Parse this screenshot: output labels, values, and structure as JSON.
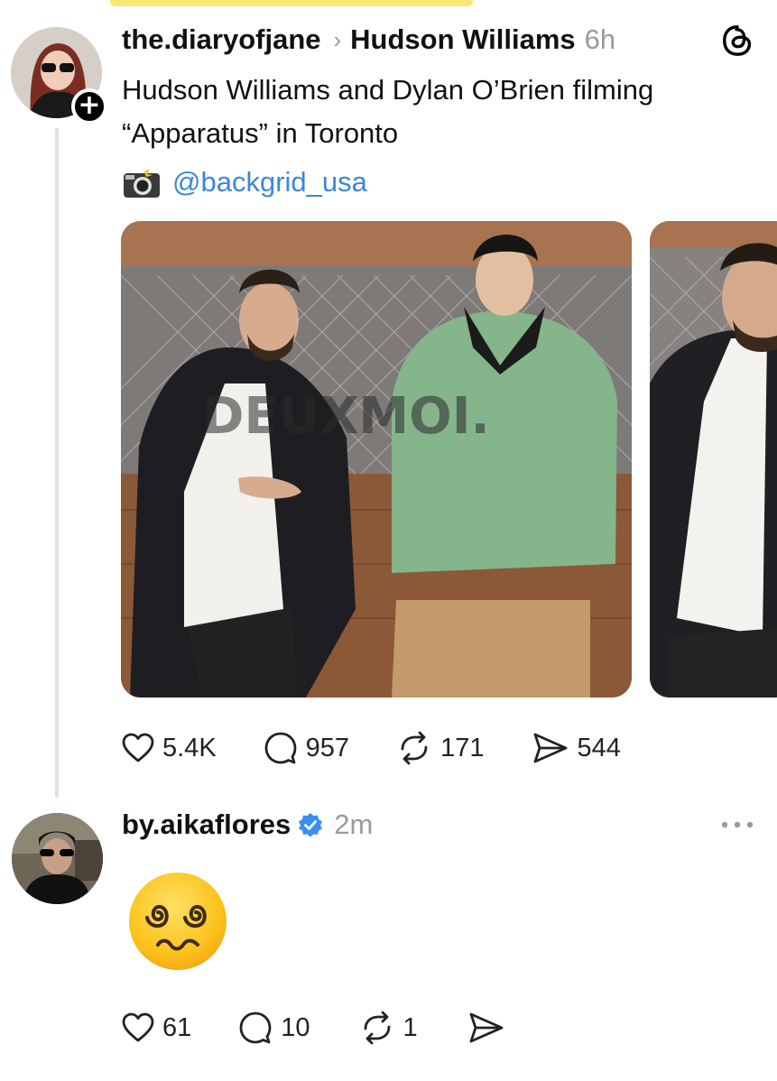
{
  "post": {
    "username": "the.diaryofjane",
    "topic": "Hudson Williams",
    "time": "6h",
    "text": "Hudson Williams and Dylan O’Brien filming “Apparatus” in Toronto",
    "credit_handle": "@backgrid_usa",
    "watermark": "DEUXMOI.",
    "stats": {
      "likes": "5.4K",
      "replies": "957",
      "reposts": "171",
      "shares": "544"
    },
    "icons": [
      "heart-icon",
      "comment-icon",
      "repost-icon",
      "share-icon",
      "threads-logo-icon",
      "camera-icon"
    ]
  },
  "reply": {
    "username": "by.aikaflores",
    "time": "2m",
    "emoji": "face-with-spiral-eyes",
    "stats": {
      "likes": "61",
      "replies": "10",
      "reposts": "1"
    }
  },
  "colors": {
    "link": "#3a87d8",
    "muted": "#9a9a9a",
    "verified": "#3b8ef3",
    "highlight": "#f6e873"
  }
}
